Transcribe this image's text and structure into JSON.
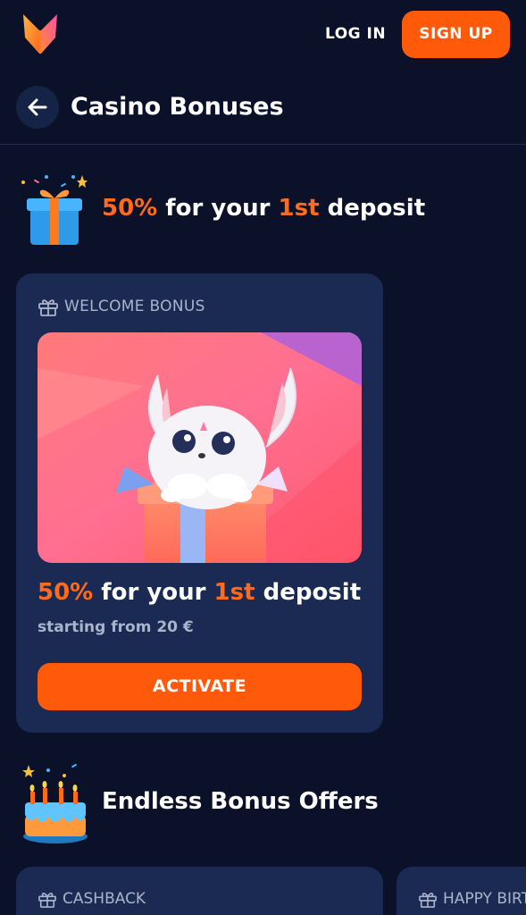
{
  "header": {
    "login_label": "LOG IN",
    "signup_label": "SIGN UP"
  },
  "titlebar": {
    "title": "Casino Bonuses"
  },
  "section1": {
    "title_parts": [
      "50%",
      " for your ",
      "1st",
      " deposit"
    ]
  },
  "welcome_card": {
    "tag": "WELCOME BONUS",
    "title_parts": [
      "50%",
      " for your ",
      "1st",
      " deposit"
    ],
    "subtitle": "starting from 20 €",
    "activate_label": "ACTIVATE"
  },
  "section2": {
    "title": "Endless Bonus Offers"
  },
  "offer_cards": [
    {
      "tag": "CASHBACK"
    },
    {
      "tag": "HAPPY BIRT"
    }
  ],
  "colors": {
    "background": "#0a1128",
    "card": "#1a2a52",
    "accent": "#ff5a0a"
  }
}
